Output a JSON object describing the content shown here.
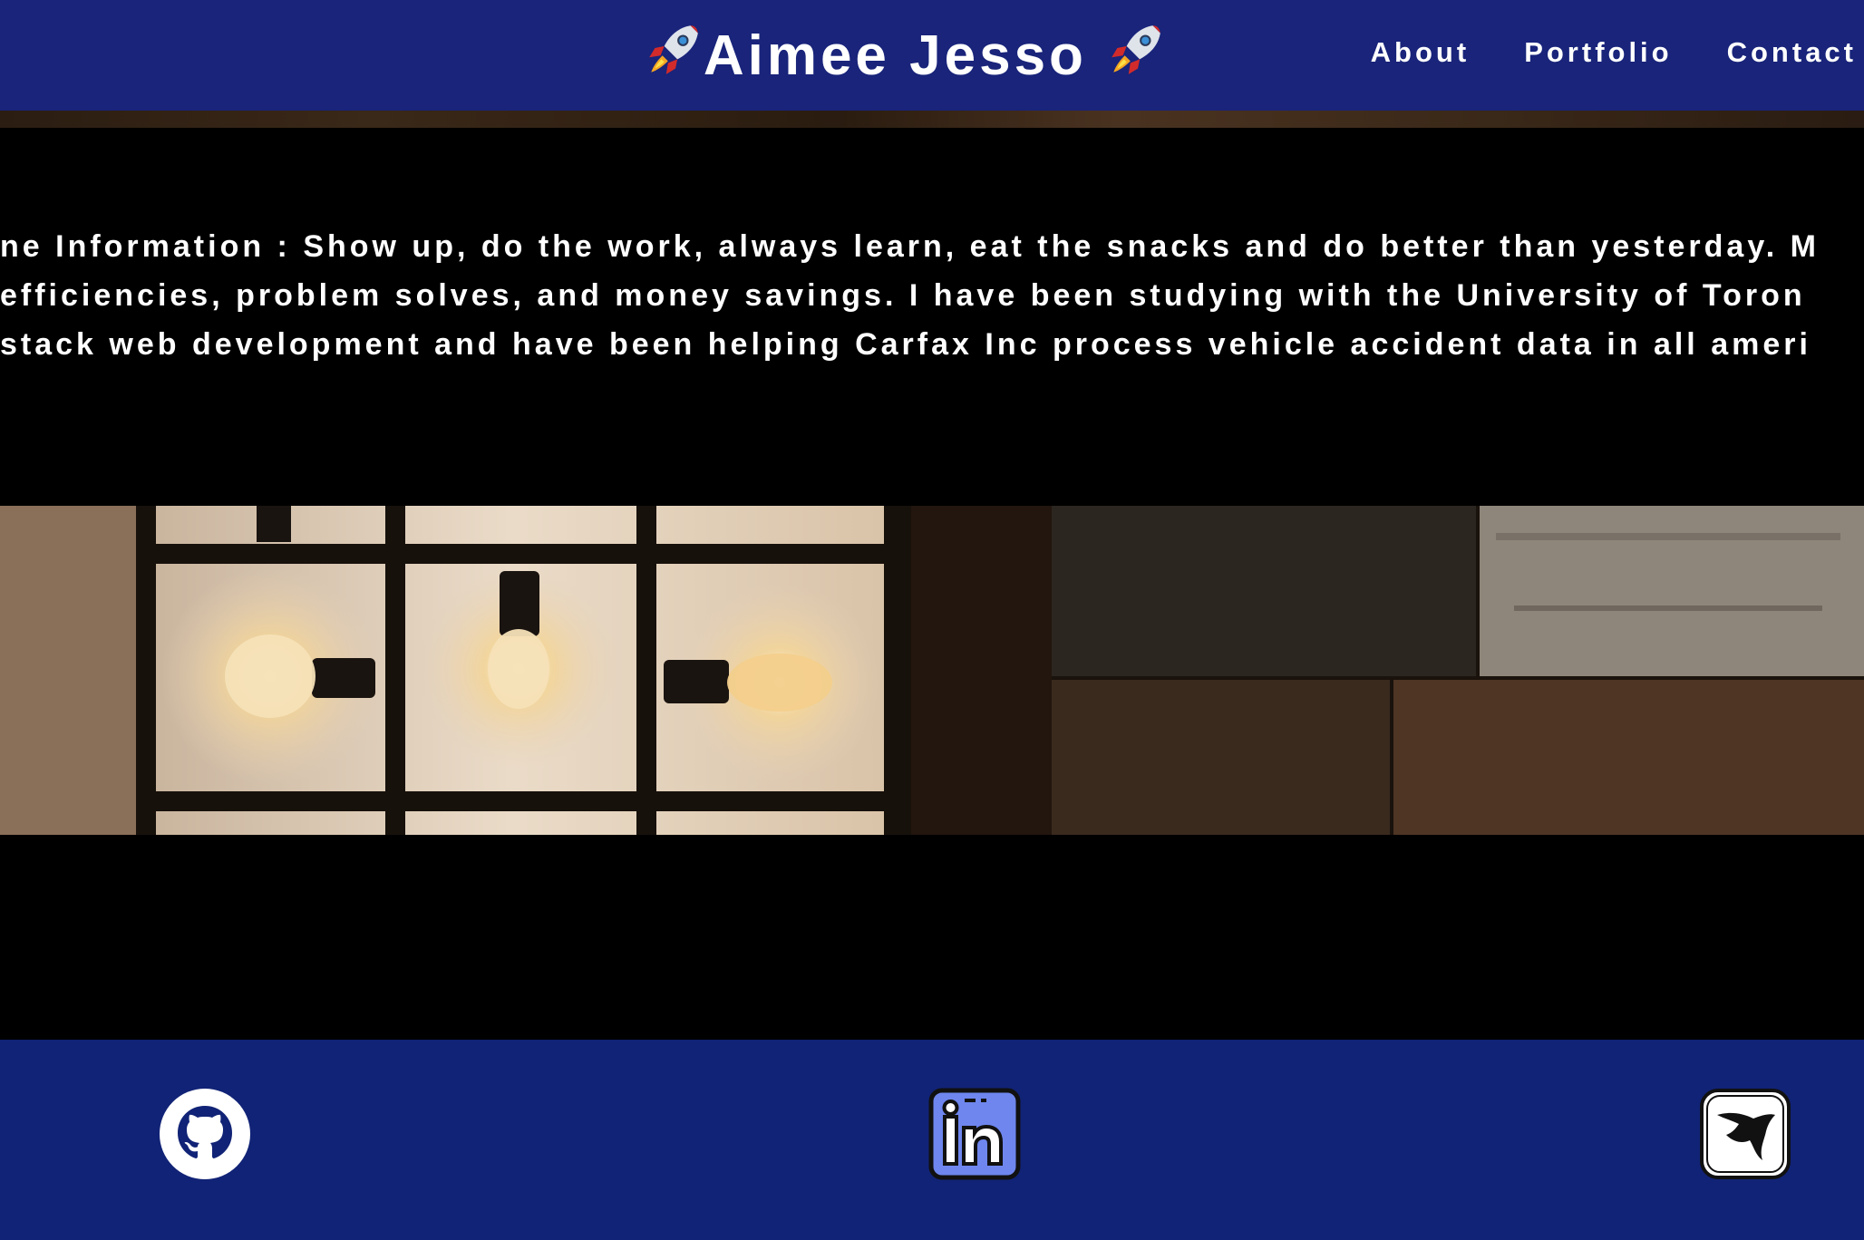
{
  "header": {
    "brand_name": "Aimee Jesso",
    "brand_icons": [
      "rocket-icon",
      "rocket-icon"
    ],
    "background_color": "#19247a",
    "nav": [
      {
        "label": "About"
      },
      {
        "label": "Portfolio"
      },
      {
        "label": "Contact"
      }
    ]
  },
  "about": {
    "lines": [
      "ne Information : Show up, do the work, always learn, eat the snacks and do better than yesterday. M",
      " efficiencies, problem solves, and money savings. I have been studying with the University of Toron",
      "stack web development and have been helping Carfax Inc process vehicle accident data in all ameri"
    ]
  },
  "footer": {
    "background_color": "#112376",
    "links": [
      {
        "icon": "github-icon"
      },
      {
        "icon": "linkedin-icon"
      },
      {
        "icon": "stingray-icon"
      }
    ]
  }
}
